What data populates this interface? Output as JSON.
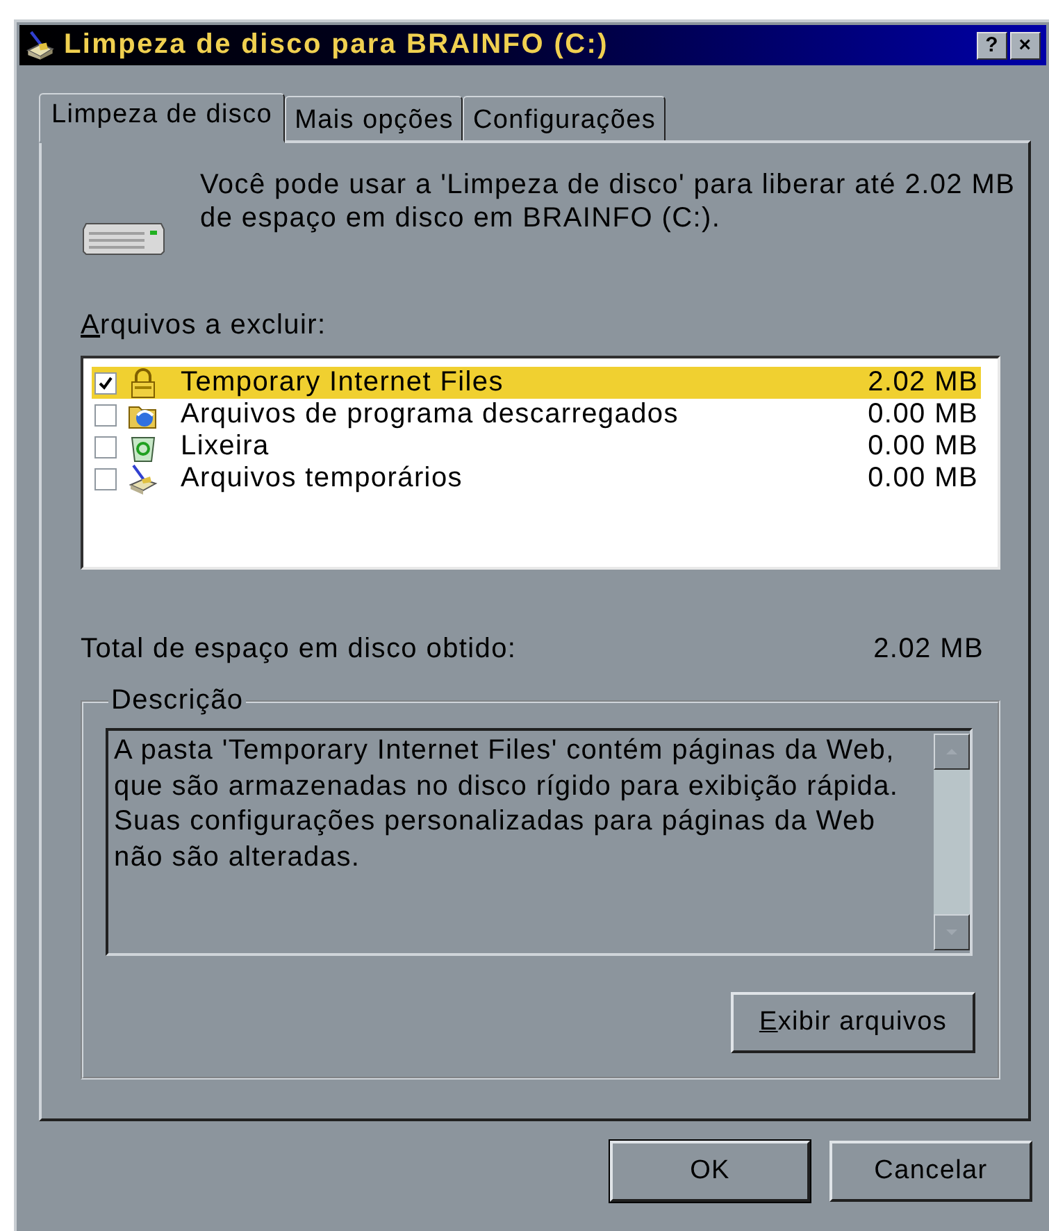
{
  "window": {
    "title": "Limpeza de disco para BRAINFO (C:)",
    "buttons": [
      "?",
      "×"
    ]
  },
  "tabs": [
    {
      "label": "Limpeza de disco",
      "selected": true
    },
    {
      "label": "Mais opções",
      "selected": false
    },
    {
      "label": "Configurações",
      "selected": false
    }
  ],
  "summary": "Você pode usar a 'Limpeza de disco' para liberar até 2.02 MB de espaço em disco em BRAINFO (C:).",
  "files_label": "Arquivos a excluir:",
  "files": [
    {
      "name": "Temporary Internet Files",
      "size": "2.02 MB",
      "checked": true,
      "selected": true
    },
    {
      "name": "Arquivos de programa descarregados",
      "size": "0.00 MB",
      "checked": false,
      "selected": false
    },
    {
      "name": "Lixeira",
      "size": "0.00 MB",
      "checked": false,
      "selected": false
    },
    {
      "name": "Arquivos temporários",
      "size": "0.00 MB",
      "checked": false,
      "selected": false
    }
  ],
  "total": {
    "label": "Total de espaço em disco obtido:",
    "value": "2.02 MB"
  },
  "description": {
    "title": "Descrição",
    "text": "A pasta 'Temporary Internet Files' contém páginas da Web, que são armazenadas no disco rígido para exibição rápida. Suas configurações personalizadas para páginas da Web não são alteradas."
  },
  "view_button": "Exibir arquivos",
  "footer_buttons": [
    "OK",
    "Cancelar"
  ]
}
